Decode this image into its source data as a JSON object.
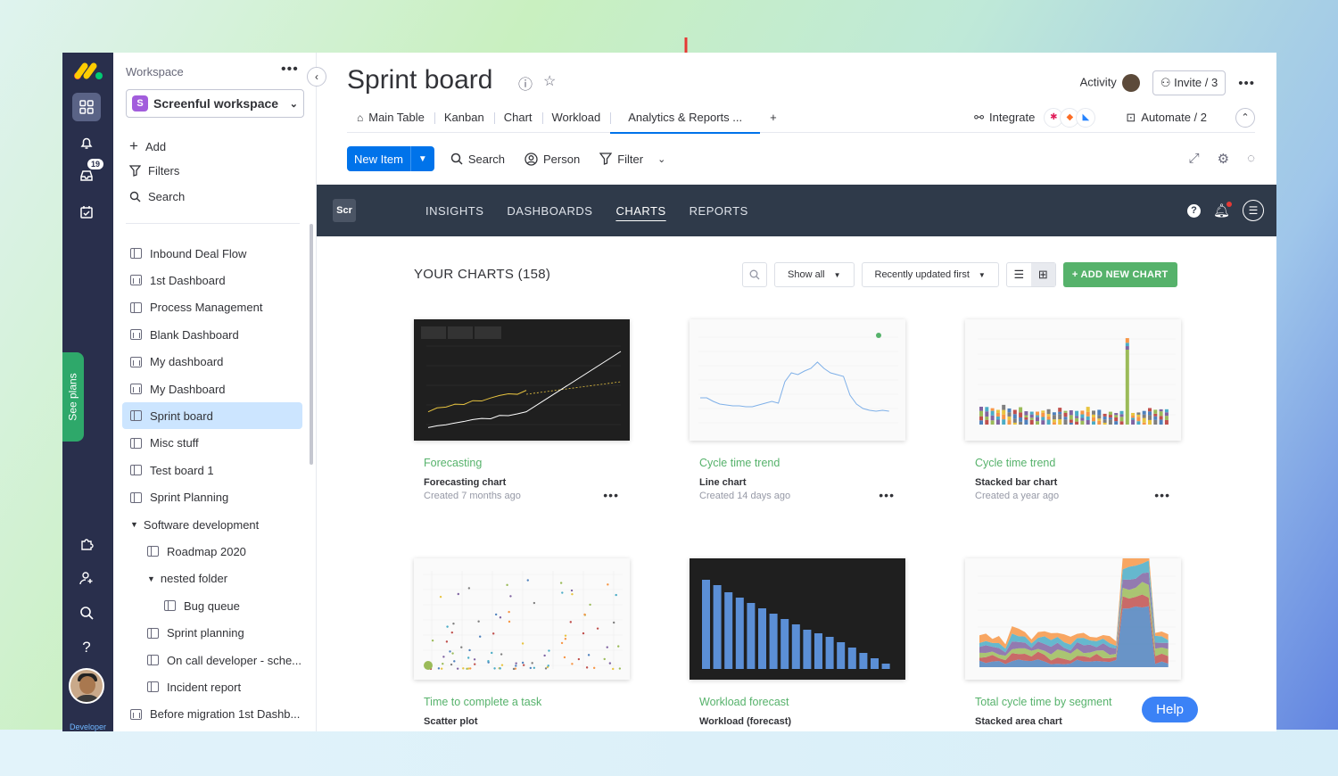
{
  "rail": {
    "inbox_badge": "19",
    "see_plans": "See plans",
    "footer": "Developer"
  },
  "sidebar": {
    "workspace_label": "Workspace",
    "workspace_name": "Screenful workspace",
    "workspace_initial": "S",
    "actions": [
      "Add",
      "Filters",
      "Search"
    ],
    "items": [
      {
        "label": "Inbound Deal Flow",
        "type": "board",
        "indent": 0
      },
      {
        "label": "1st Dashboard",
        "type": "dash",
        "indent": 0
      },
      {
        "label": "Process Management",
        "type": "board",
        "indent": 0
      },
      {
        "label": "Blank Dashboard",
        "type": "dash",
        "indent": 0
      },
      {
        "label": "My dashboard",
        "type": "dash",
        "indent": 0
      },
      {
        "label": "My Dashboard",
        "type": "dash",
        "indent": 0
      },
      {
        "label": "Sprint board",
        "type": "board",
        "indent": 0,
        "active": true
      },
      {
        "label": "Misc stuff",
        "type": "board",
        "indent": 0
      },
      {
        "label": "Test board 1",
        "type": "board",
        "indent": 0
      },
      {
        "label": "Sprint Planning",
        "type": "board",
        "indent": 0
      },
      {
        "label": "Software development",
        "type": "folder",
        "indent": 0
      },
      {
        "label": "Roadmap 2020",
        "type": "board",
        "indent": 1
      },
      {
        "label": "nested folder",
        "type": "folder",
        "indent": 1
      },
      {
        "label": "Bug queue",
        "type": "board",
        "indent": 2
      },
      {
        "label": "Sprint planning",
        "type": "board",
        "indent": 1
      },
      {
        "label": "On call developer - sche...",
        "type": "board",
        "indent": 1
      },
      {
        "label": "Incident report",
        "type": "board",
        "indent": 1
      },
      {
        "label": "Before migration 1st Dashb...",
        "type": "dash",
        "indent": 0
      }
    ]
  },
  "header": {
    "title": "Sprint board",
    "activity": "Activity",
    "invite": "Invite / 3",
    "tabs": [
      "Main Table",
      "Kanban",
      "Chart",
      "Workload",
      "Analytics & Reports ..."
    ],
    "active_tab": "Analytics & Reports ...",
    "add_tab": "+",
    "integrate": "Integrate",
    "automate": "Automate / 2"
  },
  "toolbar": {
    "new_item": "New Item",
    "search": "Search",
    "person": "Person",
    "filter": "Filter"
  },
  "embed": {
    "logo": "Scr",
    "nav": [
      "INSIGHTS",
      "DASHBOARDS",
      "CHARTS",
      "REPORTS"
    ],
    "active_nav": "CHARTS",
    "heading": "YOUR CHARTS (158)",
    "show_all": "Show all",
    "sort": "Recently updated first",
    "add_chart": "+ ADD NEW CHART",
    "help": "Help"
  },
  "cards": [
    {
      "title": "Forecasting",
      "subtitle": "Forecasting chart",
      "meta": "Created 7 months ago",
      "theme": "dark",
      "kind": "forecast"
    },
    {
      "title": "Cycle time trend",
      "subtitle": "Line chart",
      "meta": "Created 14 days ago",
      "theme": "light",
      "kind": "line"
    },
    {
      "title": "Cycle time trend",
      "subtitle": "Stacked bar chart",
      "meta": "Created a year ago",
      "theme": "light",
      "kind": "stacked"
    },
    {
      "title": "Time to complete a task",
      "subtitle": "Scatter plot",
      "meta": "",
      "theme": "light",
      "kind": "scatter"
    },
    {
      "title": "Workload forecast",
      "subtitle": "Workload (forecast)",
      "meta": "",
      "theme": "dark",
      "kind": "workload"
    },
    {
      "title": "Total cycle time by segment",
      "subtitle": "Stacked area chart",
      "meta": "",
      "theme": "light",
      "kind": "area"
    }
  ],
  "colors": {
    "rail": "#292f4c",
    "primary": "#0073ea",
    "accent_green": "#56b26b",
    "embed_nav": "#2f3a4a",
    "arrow": "#e53935"
  }
}
